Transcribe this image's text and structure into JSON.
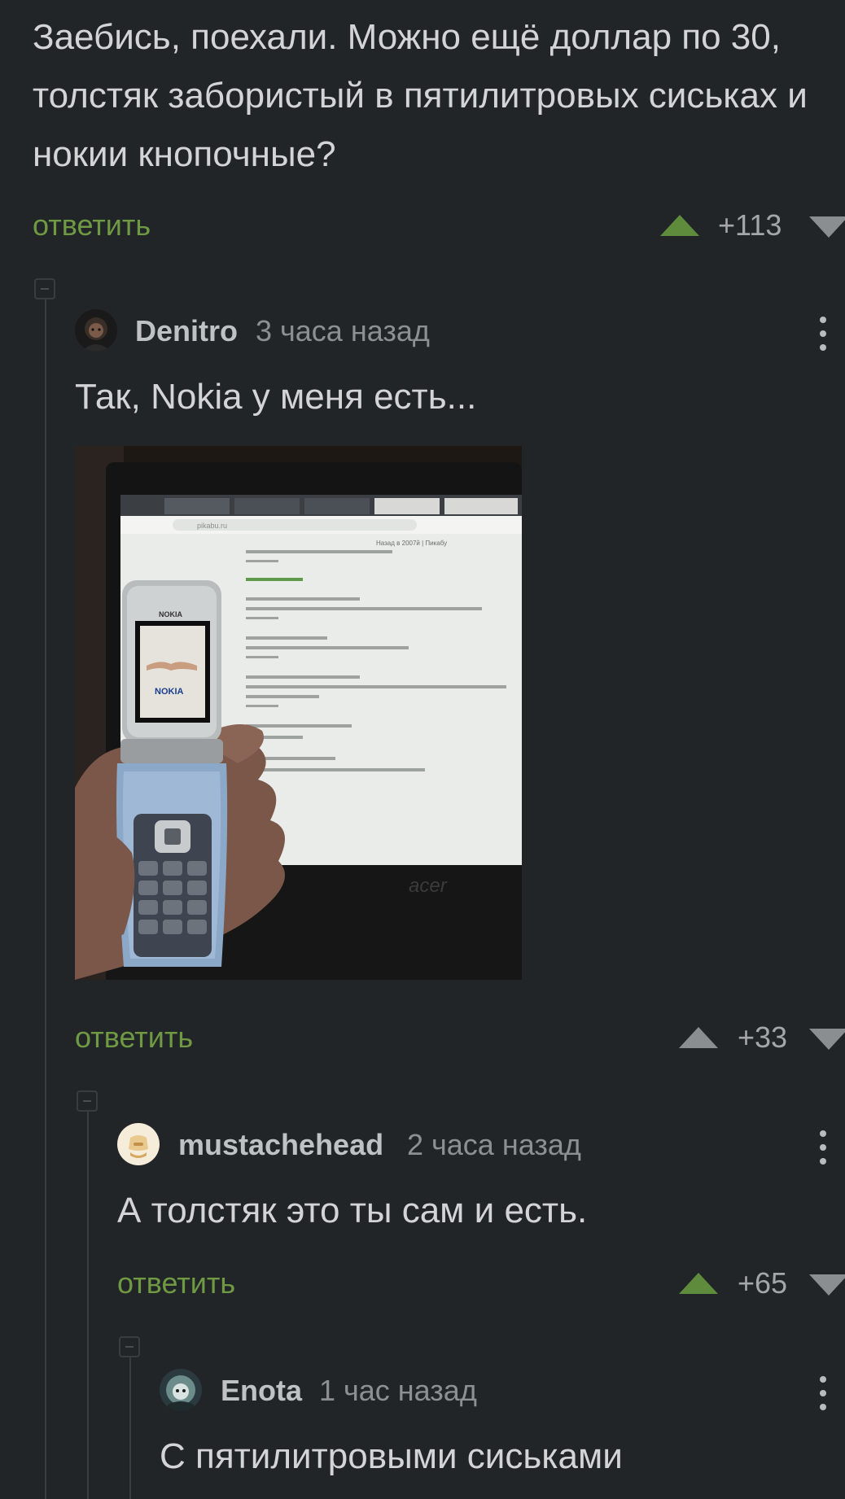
{
  "top_comment": {
    "text": "Заебись, поехали. Можно ещё доллар по 30, толстяк забористый в пятилитровых сиськах и нокии кнопочные?",
    "reply_label": "ответить",
    "score": "+113"
  },
  "comments": [
    {
      "username": "Denitro",
      "time": "3 часа назад",
      "text": "Так, Nokia у меня есть...",
      "reply_label": "ответить",
      "score": "+33",
      "photo": {
        "phone_brand": "NOKIA",
        "screen_brand": "NOKIA",
        "laptop_brand": "acer",
        "browser_url": "pikabu.ru",
        "page_title": "Назад в 2007й | Пикабу"
      }
    },
    {
      "username": "mustachehead",
      "time": "2 часа назад",
      "text": "А толстяк это ты сам и есть.",
      "reply_label": "ответить",
      "score": "+65"
    },
    {
      "username": "Enota",
      "time": "1 час назад",
      "text": "С пятилитровыми сиськами"
    }
  ],
  "icons": {
    "upvote": "triangle-up-icon",
    "downvote": "triangle-down-icon",
    "more": "kebab-menu-icon",
    "collapse": "collapse-thread-icon"
  },
  "colors": {
    "background": "#222528",
    "reply_link": "#6f9a43",
    "upvote_active": "#5f8c3c"
  }
}
